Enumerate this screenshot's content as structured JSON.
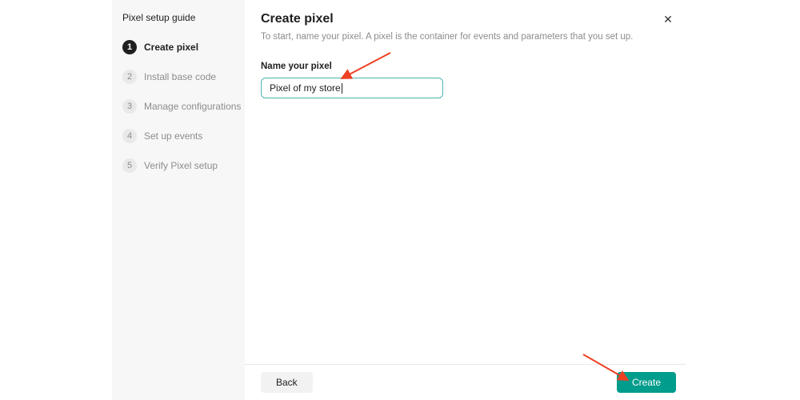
{
  "sidebar": {
    "title": "Pixel setup guide",
    "steps": [
      {
        "number": "1",
        "label": "Create pixel",
        "active": true
      },
      {
        "number": "2",
        "label": "Install base code",
        "active": false
      },
      {
        "number": "3",
        "label": "Manage configurations",
        "active": false
      },
      {
        "number": "4",
        "label": "Set up events",
        "active": false
      },
      {
        "number": "5",
        "label": "Verify Pixel setup",
        "active": false
      }
    ]
  },
  "main": {
    "title": "Create pixel",
    "description": "To start, name your pixel. A pixel is the container for events and parameters that you set up.",
    "form": {
      "label": "Name your pixel",
      "value": "Pixel of my store"
    },
    "footer": {
      "back": "Back",
      "create": "Create"
    }
  },
  "icons": {
    "close": "✕"
  },
  "colors": {
    "accent_teal": "#009c8c",
    "input_border": "#4ab5aa",
    "arrow_red": "#ee4023",
    "sidebar_bg": "#f7f7f7",
    "step_active_bg": "#1f1f1f",
    "step_inactive_bg": "#e9e9e9"
  }
}
